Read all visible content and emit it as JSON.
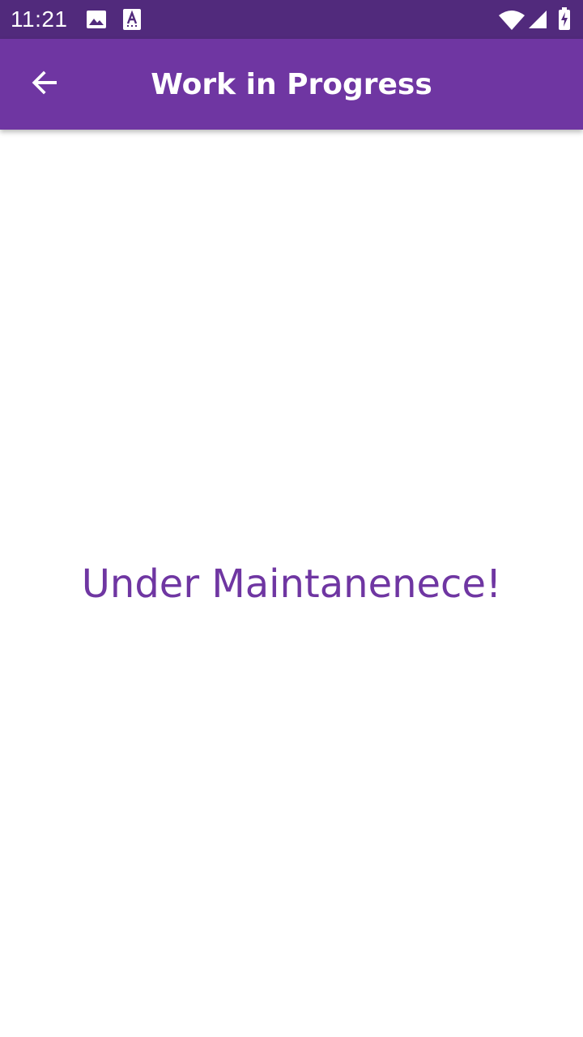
{
  "status_bar": {
    "time": "11:21",
    "left_icons": [
      "image-icon",
      "font-a-icon"
    ],
    "right_icons": [
      "wifi-icon",
      "cell-signal-icon",
      "battery-charging-icon"
    ]
  },
  "app_bar": {
    "title": "Work in Progress",
    "back_icon": "arrow-back-icon"
  },
  "content": {
    "message": "Under Maintanenece!"
  },
  "colors": {
    "status_bar": "#512a7c",
    "app_bar": "#6f36a2",
    "accent_text": "#6f36a2",
    "background": "#ffffff"
  }
}
